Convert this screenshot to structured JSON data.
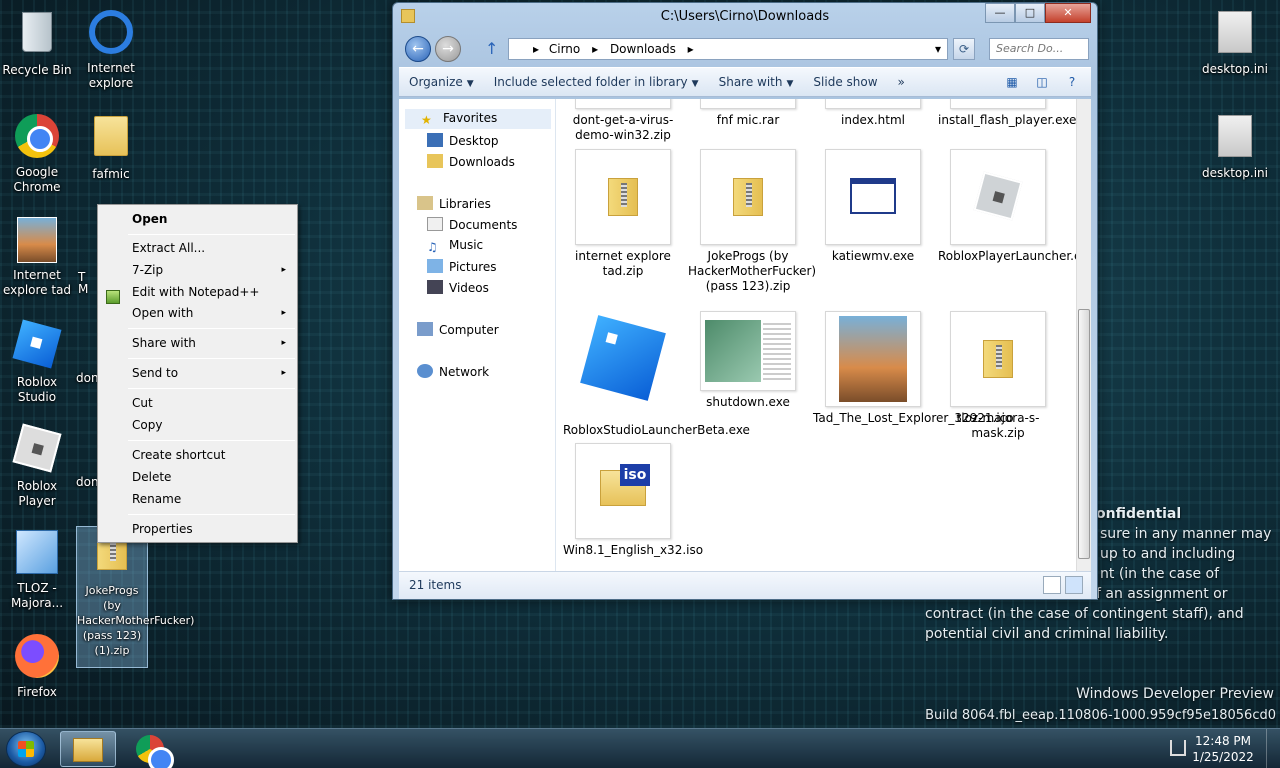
{
  "desktop": {
    "icons": [
      {
        "label": "Recycle Bin"
      },
      {
        "label": "Internet explore"
      },
      {
        "label": "Google Chrome"
      },
      {
        "label": "fafmic"
      },
      {
        "label": "Internet explore tad"
      },
      {
        "label": "Roblox Studio"
      },
      {
        "label": "Roblox Player"
      },
      {
        "label": "TLOZ - Majora..."
      },
      {
        "label": "JokeProgs (by HackerMotherFucker) (pass 123) (1).zip"
      },
      {
        "label": "Firefox"
      },
      {
        "label": "desktop.ini"
      },
      {
        "label": "desktop.ini"
      }
    ],
    "partial_labels": {
      "t1": "T",
      "m1": "M",
      "don1": "don",
      "don2": "don"
    }
  },
  "context_menu": {
    "items": [
      {
        "label": "Open"
      },
      {
        "label": "Extract All..."
      },
      {
        "label": "7-Zip"
      },
      {
        "label": "Edit with Notepad++"
      },
      {
        "label": "Open with"
      },
      {
        "label": "Share with"
      },
      {
        "label": "Send to"
      },
      {
        "label": "Cut"
      },
      {
        "label": "Copy"
      },
      {
        "label": "Create shortcut"
      },
      {
        "label": "Delete"
      },
      {
        "label": "Rename"
      },
      {
        "label": "Properties"
      }
    ],
    "submenu_arrow": "▸"
  },
  "explorer": {
    "title": "C:\\Users\\Cirno\\Downloads",
    "caption_buttons": {
      "minimize": "—",
      "maximize": "□",
      "close": "✕"
    },
    "address": {
      "crumbs": [
        "Cirno",
        "Downloads"
      ],
      "separator": "▸",
      "dropdown": "▾",
      "refresh": "⟳"
    },
    "search_placeholder": "Search Do...",
    "toolbar": {
      "organize": "Organize",
      "include": "Include selected folder in library",
      "share": "Share with",
      "slideshow": "Slide show",
      "more": "»",
      "caret": "▼"
    },
    "nav": {
      "favorites": "Favorites",
      "desktop": "Desktop",
      "downloads": "Downloads",
      "libraries": "Libraries",
      "documents": "Documents",
      "music": "Music",
      "pictures": "Pictures",
      "videos": "Videos",
      "computer": "Computer",
      "network": "Network"
    },
    "files": [
      {
        "name": "dont-get-a-virus-demo-win32.zip"
      },
      {
        "name": "fnf mic.rar"
      },
      {
        "name": "index.html"
      },
      {
        "name": "install_flash_player.exe"
      },
      {
        "name": "internet explore tad.zip"
      },
      {
        "name": "JokeProgs (by HackerMotherFucker) (pass 123).zip"
      },
      {
        "name": "katiewmv.exe"
      },
      {
        "name": "RobloxPlayerLauncher.exe"
      },
      {
        "name": "RobloxStudioLauncherBeta.exe"
      },
      {
        "name": "shutdown.exe"
      },
      {
        "name": "Tad_The_Lost_Explorer_32921.ico"
      },
      {
        "name": "tloz-majora-s-mask.zip"
      },
      {
        "name": "Win8.1_English_x32.iso"
      }
    ],
    "iso_badge": "iso",
    "status": "21 items"
  },
  "watermark": {
    "heading": "onfidential",
    "lines": [
      "sure in any manner may",
      "up to and including",
      "nt (in the case of",
      "f an assignment or",
      "contract (in the case of contingent staff), and",
      "potential civil and criminal liability."
    ],
    "build1": "Windows Developer Preview",
    "build2": "Build 8064.fbl_eeap.110806-1000.959cf95e18056cd0"
  },
  "taskbar": {
    "time": "12:48 PM",
    "date": "1/25/2022"
  }
}
